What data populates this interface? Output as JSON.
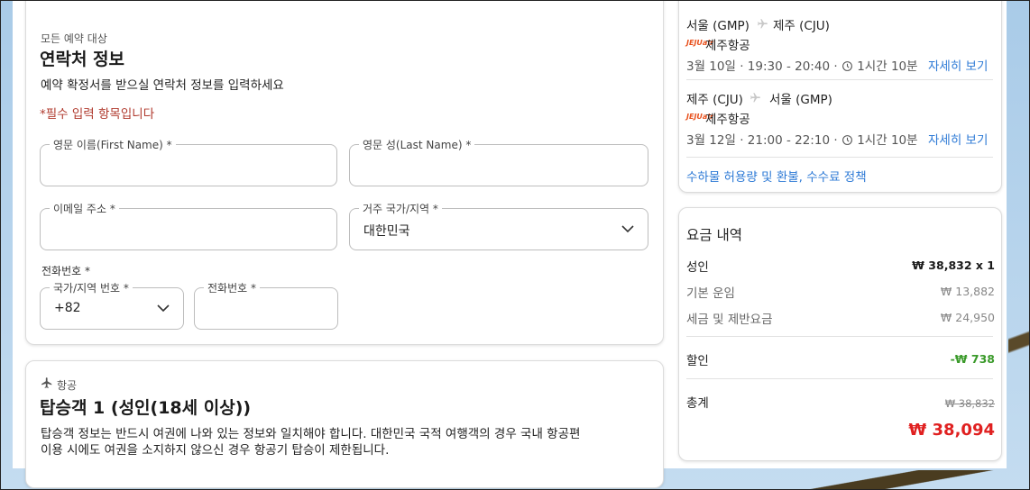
{
  "contact": {
    "eyebrow": "모든 예약 대상",
    "title": "연락처 정보",
    "description": "예약 확정서를 받으실 연락처 정보를 입력하세요",
    "required_note": "*필수 입력 항목입니다",
    "first_name_label": "영문 이름(First Name) *",
    "first_name_value": "",
    "last_name_label": "영문 성(Last Name) *",
    "last_name_value": "",
    "email_label": "이메일 주소 *",
    "email_value": "",
    "country_label": "거주 국가/지역 *",
    "country_value": "대한민국",
    "phone_section_label": "전화번호 *",
    "country_code_label": "국가/지역 번호 *",
    "country_code_value": "+82",
    "phone_label": "전화번호 *",
    "phone_value": ""
  },
  "passenger": {
    "eyebrow": "항공",
    "title": "탑승객 1 (성인(18세 이상))",
    "description_line1": "탑승객 정보는 반드시 여권에 나와 있는 정보와 일치해야 합니다. 대한민국 국적 여행객의 경우 국내 항공편",
    "description_line2": "이용 시에도 여권을 소지하지 않으신 경우 항공기 탑승이 제한됩니다."
  },
  "flights": [
    {
      "from": "서울 (GMP)",
      "to": "제주 (CJU)",
      "airline": "제주항공",
      "airline_logo": "JEJUair",
      "schedule": "3월 10일 · 19:30 - 20:40 · ",
      "duration": "1시간 10분",
      "details_link": "자세히 보기"
    },
    {
      "from": "제주 (CJU)",
      "to": "서울 (GMP)",
      "airline": "제주항공",
      "airline_logo": "JEJUair",
      "schedule": "3월 12일 · 21:00 - 22:10 · ",
      "duration": "1시간 10분",
      "details_link": "자세히 보기"
    }
  ],
  "policy_link": "수하물 허용량 및 환불, 수수료 정책",
  "fare": {
    "title": "요금 내역",
    "adult_label": "성인",
    "adult_value": "₩ 38,832 x 1",
    "base_label": "기본 운임",
    "base_value": "₩ 13,882",
    "tax_label": "세금 및 제반요금",
    "tax_value": "₩ 24,950",
    "discount_label": "할인",
    "discount_value": "-₩ 738",
    "total_label": "총계",
    "total_original": "₩ 38,832",
    "total_value": "₩ 38,094"
  },
  "colors": {
    "link": "#2f7bd6",
    "required": "#b03a2e",
    "discount": "#3a9a2a",
    "total": "#e02020"
  }
}
